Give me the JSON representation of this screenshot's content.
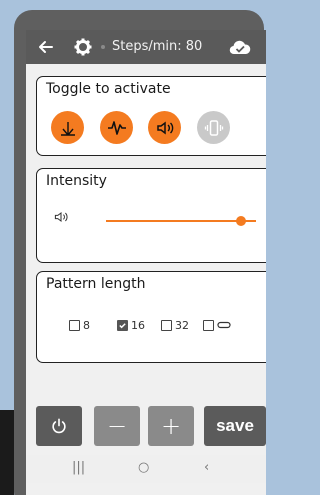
{
  "appbar": {
    "title": "Steps/min: 80",
    "back_icon": "arrow-left-icon",
    "settings_icon": "gear-icon",
    "cloud_icon": "cloud-check-icon"
  },
  "toggle_card": {
    "title": "Toggle to activate",
    "buttons": [
      {
        "name": "metronome-toggle",
        "icon": "metronome-icon",
        "active": true
      },
      {
        "name": "pulse-toggle",
        "icon": "waveform-icon",
        "active": true
      },
      {
        "name": "sound-toggle",
        "icon": "speaker-icon",
        "active": true
      },
      {
        "name": "vibrate-toggle",
        "icon": "vibrate-icon",
        "active": false
      }
    ],
    "active_color": "#f47b20",
    "inactive_color": "#c9c9c9"
  },
  "intensity_card": {
    "title": "Intensity",
    "icon": "speaker-icon",
    "level": 0.9
  },
  "pattern_card": {
    "title": "Pattern length",
    "options": [
      {
        "label": "8",
        "checked": false
      },
      {
        "label": "16",
        "checked": true
      },
      {
        "label": "32",
        "checked": false
      },
      {
        "label": "",
        "icon": "loop-icon",
        "checked": false
      }
    ]
  },
  "bottom_bar": {
    "power_icon": "power-icon",
    "minus_label": "−",
    "plus_label": "+",
    "save_label": "save"
  },
  "navbar": {
    "recent": "|||",
    "home": "○",
    "back": "‹"
  }
}
